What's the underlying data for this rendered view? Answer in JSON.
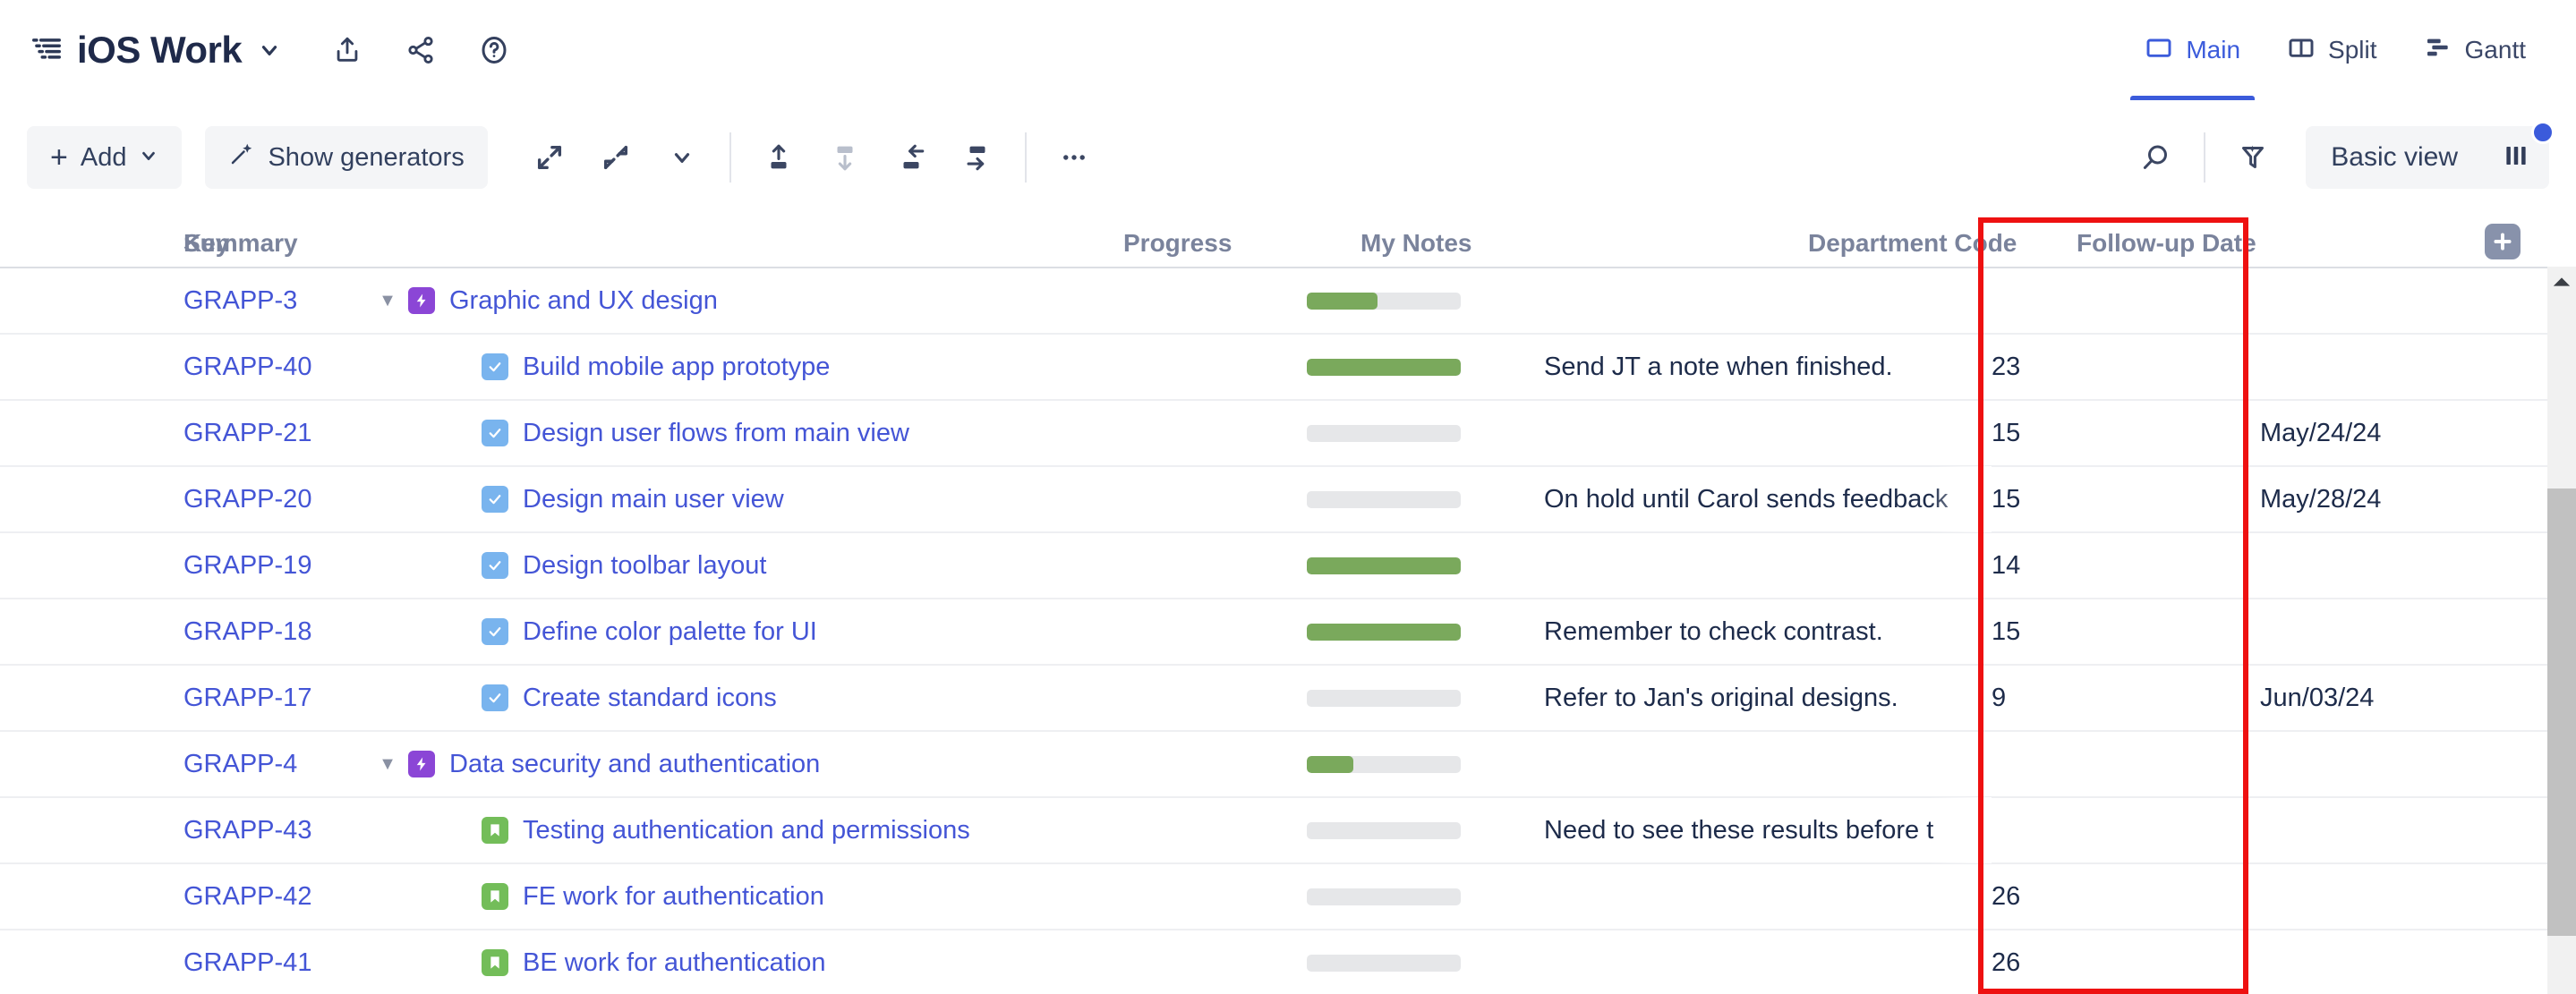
{
  "header": {
    "project_icon": "structure-icon",
    "title": "iOS Work",
    "title_caret": "chevron-down-icon",
    "actions": [
      {
        "name": "export-icon",
        "label": "Export"
      },
      {
        "name": "share-icon",
        "label": "Share"
      },
      {
        "name": "help-icon",
        "label": "Help"
      }
    ],
    "view_tabs": [
      {
        "label": "Main",
        "icon": "panel-icon",
        "active": true
      },
      {
        "label": "Split",
        "icon": "split-icon",
        "active": false
      },
      {
        "label": "Gantt",
        "icon": "gantt-icon",
        "active": false
      }
    ]
  },
  "toolbar": {
    "add_label": "Add",
    "add_icon": "plus-icon",
    "add_caret": "chevron-down-icon",
    "generators_label": "Show generators",
    "generators_icon": "magic-wand-icon",
    "expand_all_icon": "expand-icon",
    "collapse_all_icon": "collapse-icon",
    "expand_caret_icon": "chevron-down-icon",
    "move_up_icon": "move-up-icon",
    "move_down_icon": "move-down-icon",
    "outdent_icon": "outdent-icon",
    "indent_icon": "indent-icon",
    "more_icon": "more-ellipsis-icon",
    "search_icon": "search-icon",
    "filter_icon": "magic-filter-icon",
    "basic_view_label": "Basic view",
    "columns_icon": "columns-icon",
    "columns_badge": true
  },
  "table": {
    "columns": [
      {
        "key": "key",
        "label": "Key"
      },
      {
        "key": "summary",
        "label": "Summary"
      },
      {
        "key": "progress",
        "label": "Progress"
      },
      {
        "key": "notes",
        "label": "My Notes"
      },
      {
        "key": "dept",
        "label": "Department Code"
      },
      {
        "key": "follow",
        "label": "Follow-up Date"
      }
    ],
    "add_column_icon": "plus-square-icon",
    "rows": [
      {
        "key": "GRAPP-3",
        "twisty": "▼",
        "indent": 0,
        "type": "epic",
        "summary": "Graphic and UX design",
        "progress": 46,
        "notes": "",
        "notes_truncated": false,
        "dept": "",
        "follow": ""
      },
      {
        "key": "GRAPP-40",
        "twisty": "",
        "indent": 1,
        "type": "task",
        "summary": "Build mobile app prototype",
        "progress": 100,
        "notes": "Send JT a note when finished.",
        "notes_truncated": false,
        "dept": "23",
        "follow": ""
      },
      {
        "key": "GRAPP-21",
        "twisty": "",
        "indent": 1,
        "type": "task",
        "summary": "Design user flows from main view",
        "progress": 0,
        "notes": "",
        "notes_truncated": false,
        "dept": "15",
        "follow": "May/24/24"
      },
      {
        "key": "GRAPP-20",
        "twisty": "",
        "indent": 1,
        "type": "task",
        "summary": "Design main user view",
        "progress": 0,
        "notes": "On hold until Carol sends feedback",
        "notes_truncated": true,
        "dept": "15",
        "follow": "May/28/24"
      },
      {
        "key": "GRAPP-19",
        "twisty": "",
        "indent": 1,
        "type": "task",
        "summary": "Design toolbar layout",
        "progress": 100,
        "notes": "",
        "notes_truncated": false,
        "dept": "14",
        "follow": ""
      },
      {
        "key": "GRAPP-18",
        "twisty": "",
        "indent": 1,
        "type": "task",
        "summary": "Define color palette for UI",
        "progress": 100,
        "notes": "Remember to check contrast.",
        "notes_truncated": false,
        "dept": "15",
        "follow": ""
      },
      {
        "key": "GRAPP-17",
        "twisty": "",
        "indent": 1,
        "type": "task",
        "summary": "Create standard icons",
        "progress": 0,
        "notes": "Refer to Jan's original designs.",
        "notes_truncated": false,
        "dept": "9",
        "follow": "Jun/03/24"
      },
      {
        "key": "GRAPP-4",
        "twisty": "▼",
        "indent": 0,
        "type": "epic",
        "summary": "Data security and authentication",
        "progress": 30,
        "notes": "",
        "notes_truncated": false,
        "dept": "",
        "follow": ""
      },
      {
        "key": "GRAPP-43",
        "twisty": "",
        "indent": 1,
        "type": "story",
        "summary": "Testing authentication and permissions",
        "progress": 0,
        "notes": "Need to see these results before t",
        "notes_truncated": true,
        "dept": "",
        "follow": ""
      },
      {
        "key": "GRAPP-42",
        "twisty": "",
        "indent": 1,
        "type": "story",
        "summary": "FE work for authentication",
        "progress": 0,
        "notes": "",
        "notes_truncated": false,
        "dept": "26",
        "follow": ""
      },
      {
        "key": "GRAPP-41",
        "twisty": "",
        "indent": 1,
        "type": "story",
        "summary": "BE work for authentication",
        "progress": 0,
        "notes": "",
        "notes_truncated": false,
        "dept": "26",
        "follow": ""
      }
    ]
  },
  "annotation": {
    "name": "department-code-highlight",
    "color": "#ee1111"
  },
  "scrollbar": {
    "up_arrow_icon": "scroll-up-arrow-icon"
  }
}
